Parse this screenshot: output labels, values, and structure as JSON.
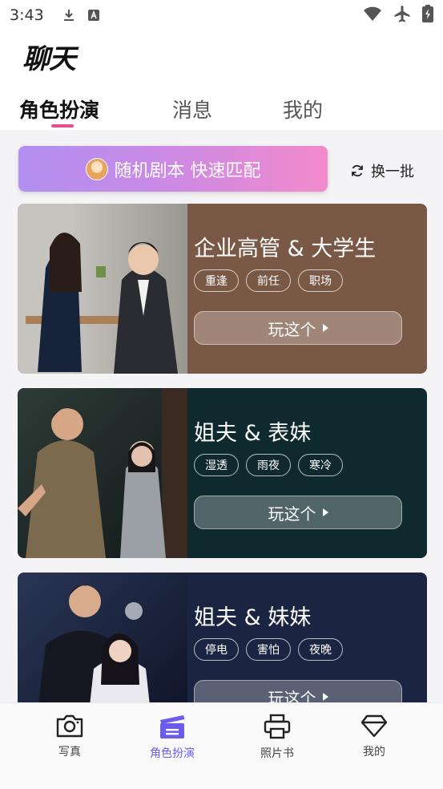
{
  "status_bar": {
    "time": "3:43"
  },
  "header": {
    "title": "聊天"
  },
  "tabs": [
    {
      "label": "角色扮演",
      "active": true
    },
    {
      "label": "消息",
      "active": false
    },
    {
      "label": "我的",
      "active": false
    }
  ],
  "match": {
    "label": "随机剧本 快速匹配",
    "refresh_label": "换一批"
  },
  "cards": [
    {
      "title": "企业高管 & 大学生",
      "tags": [
        "重逢",
        "前任",
        "职场"
      ],
      "play_label": "玩这个",
      "bg_color": "#7a5846"
    },
    {
      "title": "姐夫 & 表妹",
      "tags": [
        "湿透",
        "雨夜",
        "寒冷"
      ],
      "play_label": "玩这个",
      "bg_color": "#0f2a2f"
    },
    {
      "title": "姐夫 & 妹妹",
      "tags": [
        "停电",
        "害怕",
        "夜晚"
      ],
      "play_label": "玩这个",
      "bg_color": "#1b2440"
    }
  ],
  "bottom_nav": [
    {
      "label": "写真",
      "icon": "camera-icon",
      "active": false
    },
    {
      "label": "角色扮演",
      "icon": "clapperboard-icon",
      "active": true
    },
    {
      "label": "照片书",
      "icon": "printer-icon",
      "active": false
    },
    {
      "label": "我的",
      "icon": "diamond-icon",
      "active": false
    }
  ],
  "colors": {
    "accent": "#6b5cf0",
    "tab_indicator": "#f04a8a"
  }
}
